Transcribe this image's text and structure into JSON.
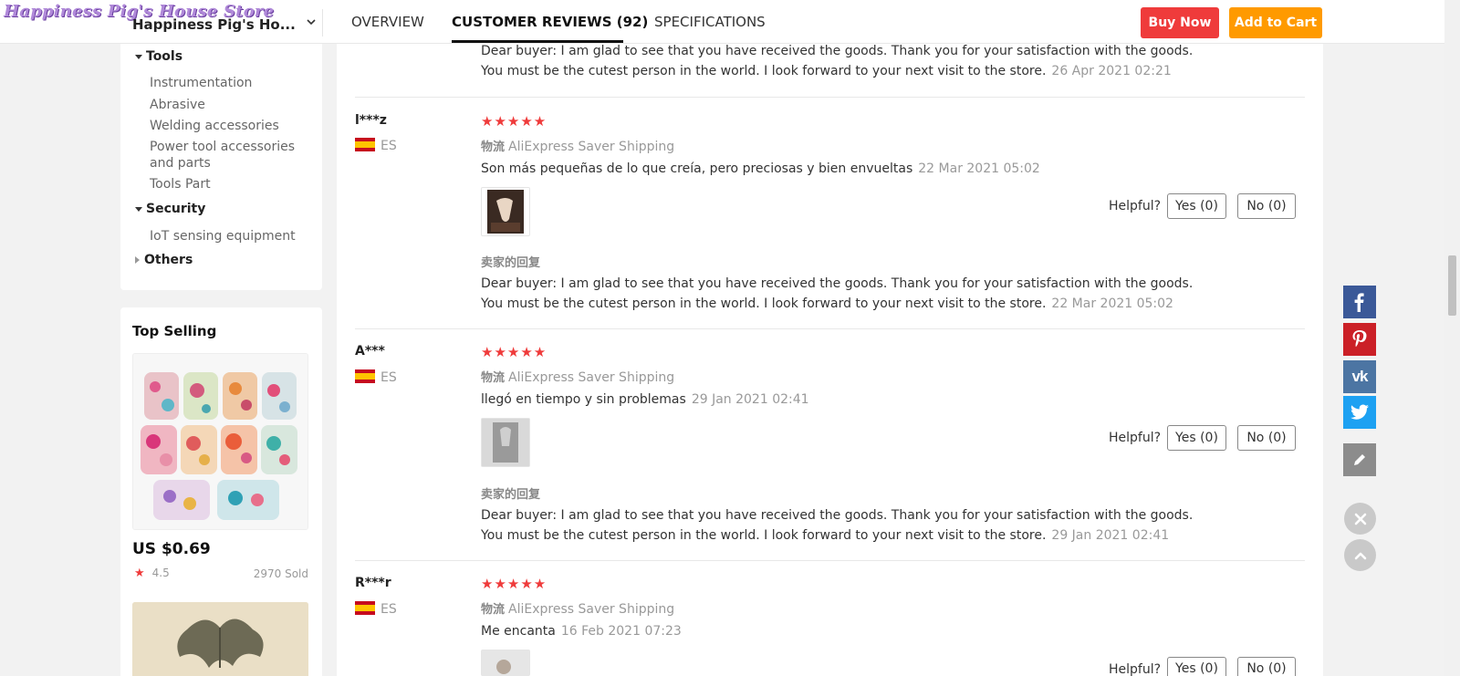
{
  "header": {
    "logo_text": "Happiness Pig's House Store",
    "store_name": "Happiness Pig's Ho...",
    "tabs": [
      {
        "label": "OVERVIEW"
      },
      {
        "label": "CUSTOMER REVIEWS (92)"
      },
      {
        "label": "SPECIFICATIONS"
      }
    ],
    "buy_now": "Buy Now",
    "add_to_cart": "Add to Cart"
  },
  "sidebar": {
    "groups": [
      {
        "label": "Tools",
        "items": [
          "Instrumentation",
          "Abrasive",
          "Welding accessories",
          "Power tool accessories and parts",
          "Tools Part"
        ]
      },
      {
        "label": "Security",
        "items": [
          "IoT sensing equipment"
        ]
      },
      {
        "label": "Others",
        "items": []
      }
    ],
    "top_selling": {
      "title": "Top Selling",
      "product": {
        "price": "US $0.69",
        "rating": "4.5",
        "sold": "2970 Sold"
      }
    }
  },
  "reviews": {
    "top_reply": {
      "line1": "Dear buyer: I am glad to see that you have received the goods. Thank you for your satisfaction with the goods.",
      "line2": "You must be the cutest person in the world. I look forward to your next visit to the store.",
      "date": "26 Apr 2021 02:21"
    },
    "items": [
      {
        "user": "l***z",
        "country": "ES",
        "stars": "★★★★★",
        "shipping_label": "物流",
        "shipping": "AliExpress Saver Shipping",
        "text": "Son más pequeñas de lo que creía, pero preciosas y bien envueltas",
        "date": "22 Mar 2021 05:02",
        "helpful": "Helpful?",
        "yes": "Yes (0)",
        "no": "No (0)",
        "seller_label": "卖家的回复",
        "reply1": "Dear buyer: I am glad to see that you have received the goods. Thank you for your satisfaction with the goods.",
        "reply2": "You must be the cutest person in the world. I look forward to your next visit to the store.",
        "reply_date": "22 Mar 2021 05:02"
      },
      {
        "user": "A***",
        "country": "ES",
        "stars": "★★★★★",
        "shipping_label": "物流",
        "shipping": "AliExpress Saver Shipping",
        "text": "llegó en tiempo y sin problemas",
        "date": "29 Jan 2021 02:41",
        "helpful": "Helpful?",
        "yes": "Yes (0)",
        "no": "No (0)",
        "seller_label": "卖家的回复",
        "reply1": "Dear buyer: I am glad to see that you have received the goods. Thank you for your satisfaction with the goods.",
        "reply2": "You must be the cutest person in the world. I look forward to your next visit to the store.",
        "reply_date": "29 Jan 2021 02:41"
      },
      {
        "user": "R***r",
        "country": "ES",
        "stars": "★★★★★",
        "shipping_label": "物流",
        "shipping": "AliExpress Saver Shipping",
        "text": "Me encanta",
        "date": "16 Feb 2021 07:23",
        "helpful": "Helpful?",
        "yes": "Yes (0)",
        "no": "No (0)"
      }
    ]
  },
  "share": {
    "icons": [
      "facebook-icon",
      "pinterest-icon",
      "vk-icon",
      "twitter-icon",
      "edit-icon"
    ],
    "colors": {
      "facebook": "#3b5998",
      "pinterest": "#cb2027",
      "vk": "#4c75a3",
      "twitter": "#1da1f2"
    }
  },
  "colors": {
    "accent_red": "#ef3b3b",
    "accent_orange": "#ff9a00"
  }
}
